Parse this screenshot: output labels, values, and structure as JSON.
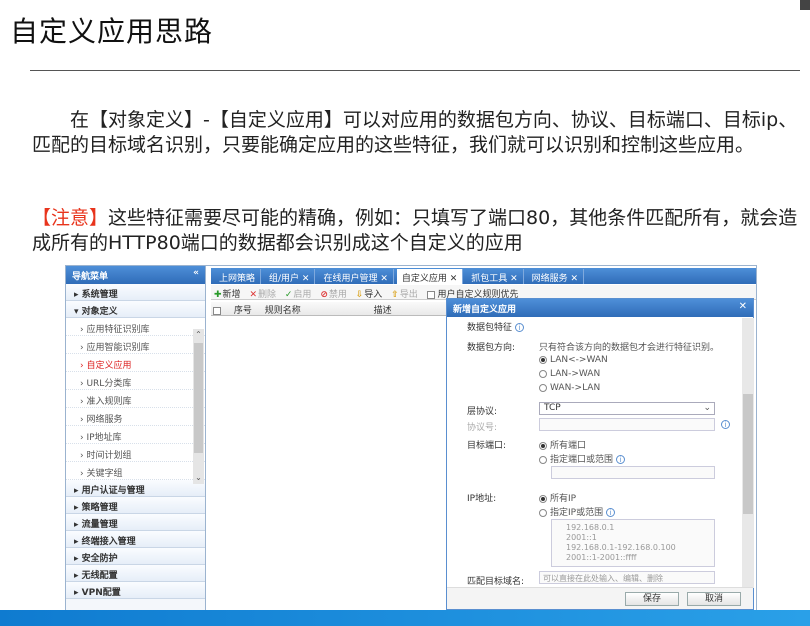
{
  "slide": {
    "title": "自定义应用思路",
    "para1": "在【对象定义】-【自定义应用】可以对应用的数据包方向、协议、目标端口、目标ip、匹配的目标域名识别，只要能确定应用的这些特征，我们就可以识别和控制这些应用。",
    "note_label": "【注意】",
    "note_text": "这些特征需要尽可能的精确，例如：只填写了端口80，其他条件匹配所有，就会造成所有的HTTP80端口的数据都会识别成这个自定义的应用"
  },
  "nav": {
    "header": "导航菜单",
    "collapse_icon": "«",
    "groups_top": [
      {
        "label": "▸ 系统管理"
      },
      {
        "label": "▾ 对象定义"
      }
    ],
    "subitems": [
      {
        "label": "› 应用特征识别库"
      },
      {
        "label": "› 应用智能识别库"
      },
      {
        "label": "› 自定义应用"
      },
      {
        "label": "› URL分类库"
      },
      {
        "label": "› 准入规则库"
      },
      {
        "label": "› 网络服务"
      },
      {
        "label": "› IP地址库"
      },
      {
        "label": "› 时间计划组"
      },
      {
        "label": "› 关键字组"
      }
    ],
    "groups_bottom": [
      {
        "label": "▸ 用户认证与管理"
      },
      {
        "label": "▸ 策略管理"
      },
      {
        "label": "▸ 流量管理"
      },
      {
        "label": "▸ 终端接入管理"
      },
      {
        "label": "▸ 安全防护"
      },
      {
        "label": "▸ 无线配置"
      },
      {
        "label": "▸ VPN配置"
      }
    ]
  },
  "tabs": [
    "上网策略",
    "组/用户 ✕",
    "在线用户管理 ✕",
    "自定义应用 ✕",
    "抓包工具 ✕",
    "网络服务 ✕"
  ],
  "toolbar": {
    "add": "新增",
    "delete": "删除",
    "enable": "启用",
    "disable": "禁用",
    "import": "导入",
    "export": "导出",
    "priority": "用户自定义规则优先"
  },
  "grid": {
    "col_seq": "序号",
    "col_name": "规则名称",
    "col_desc": "描述"
  },
  "dialog": {
    "title": "新增自定义应用",
    "close": "✕",
    "section": "数据包特征",
    "direction_label": "数据包方向:",
    "direction_hint": "只有符合该方向的数据包才会进行特征识别。",
    "direction_options": [
      "LAN<->WAN",
      "LAN->WAN",
      "WAN->LAN"
    ],
    "protocol_label": "层协议:",
    "protocol_value": "TCP",
    "protocol_no_label": "协议号:",
    "port_label": "目标端口:",
    "port_all": "所有端口",
    "port_specify": "指定端口或范围",
    "ip_label": "IP地址:",
    "ip_all": "所有IP",
    "ip_specify": "指定IP或范围",
    "ip_placeholder_lines": [
      "192.168.0.1",
      "2001::1",
      "192.168.0.1-192.168.0.100",
      "2001::1-2001::ffff"
    ],
    "domain_label": "匹配目标域名:",
    "domain_placeholder": "可以直接在此处输入、编辑、删除",
    "save": "保存",
    "cancel": "取消"
  }
}
